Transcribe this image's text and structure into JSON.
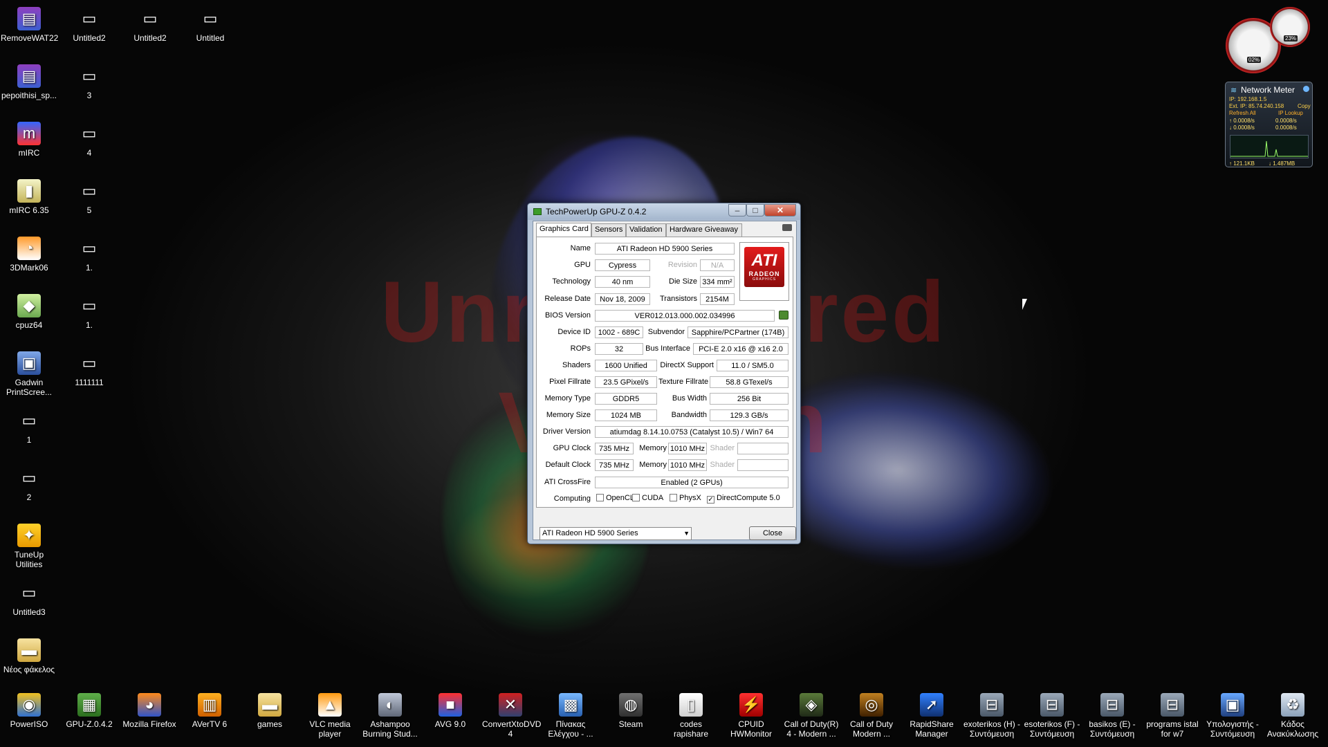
{
  "watermark": {
    "line1": "Unregistered",
    "line2": "Version"
  },
  "desktop_icons_left": [
    {
      "label": "RemoveWAT22",
      "icon": "winrar-archive-icon"
    },
    {
      "label": "Untitled2",
      "icon": "image-file-icon"
    },
    {
      "label": "Untitled2",
      "icon": "image-file-icon"
    },
    {
      "label": "Untitled",
      "icon": "image-file-icon"
    },
    {
      "label": "pepoithisi_sp...",
      "icon": "winrar-archive-icon"
    },
    {
      "label": "3",
      "icon": "image-file-icon"
    },
    {
      "label": "mIRC",
      "icon": "mirc-icon"
    },
    {
      "label": "4",
      "icon": "image-file-icon"
    },
    {
      "label": "mIRC 6.35",
      "icon": "installer-icon"
    },
    {
      "label": "5",
      "icon": "image-file-icon"
    },
    {
      "label": "3DMark06",
      "icon": "3dmark-icon"
    },
    {
      "label": "1.",
      "icon": "image-file-icon"
    },
    {
      "label": "cpuz64",
      "icon": "cpuz-icon"
    },
    {
      "label": "1.",
      "icon": "image-file-icon"
    },
    {
      "label": "Gadwin PrintScree...",
      "icon": "gadwin-icon"
    },
    {
      "label": "1111111",
      "icon": "image-file-icon"
    },
    {
      "label": "1",
      "icon": "image-file-icon"
    },
    {
      "label": "2",
      "icon": "image-file-icon"
    },
    {
      "label": "TuneUp Utilities",
      "icon": "tuneup-icon"
    },
    {
      "label": "Untitled3",
      "icon": "image-file-icon"
    },
    {
      "label": "Νέος φάκελος",
      "icon": "folder-icon"
    }
  ],
  "desktop_icons_bottom": [
    {
      "label": "PowerISO",
      "icon": "poweriso-icon"
    },
    {
      "label": "GPU-Z.0.4.2",
      "icon": "gpuz-icon"
    },
    {
      "label": "Mozilla Firefox",
      "icon": "firefox-icon"
    },
    {
      "label": "AVerTV 6",
      "icon": "avertv-icon"
    },
    {
      "label": "games",
      "icon": "folder-icon"
    },
    {
      "label": "VLC media player",
      "icon": "vlc-icon"
    },
    {
      "label": "Ashampoo Burning Stud...",
      "icon": "ashampoo-icon"
    },
    {
      "label": "AVG 9.0",
      "icon": "avg-icon"
    },
    {
      "label": "ConvertXtoDVD 4",
      "icon": "convertxtodvd-icon"
    },
    {
      "label": "Πίνακας Ελέγχου - ...",
      "icon": "control-panel-icon"
    },
    {
      "label": "Steam",
      "icon": "steam-icon"
    },
    {
      "label": "codes rapishare",
      "icon": "text-file-icon"
    },
    {
      "label": "CPUID HWMonitor",
      "icon": "hwmonitor-icon"
    },
    {
      "label": "Call of Duty(R) 4 - Modern ...",
      "icon": "cod4-icon"
    },
    {
      "label": "Call of Duty Modern ...",
      "icon": "cod-mw-icon"
    },
    {
      "label": "RapidShare Manager",
      "icon": "rapidshare-icon"
    },
    {
      "label": "exoterikos (H) - Συντόμευση",
      "icon": "drive-shortcut-icon"
    },
    {
      "label": "esoterikos (F) - Συντόμευση",
      "icon": "drive-shortcut-icon"
    },
    {
      "label": "basikos (E) - Συντόμευση",
      "icon": "drive-shortcut-icon"
    },
    {
      "label": "programs istal for w7",
      "icon": "drive-shortcut-icon"
    },
    {
      "label": "Υπολογιστής - Συντόμευση",
      "icon": "computer-icon"
    },
    {
      "label": "Κάδος Ανακύκλωσης",
      "icon": "recycle-bin-icon"
    }
  ],
  "gauge": {
    "cpu": "02%",
    "ram": "23%"
  },
  "network_meter": {
    "title": "Network Meter",
    "ip": "IP: 192.168.1.5",
    "ext_ip": "Ext. IP: 85.74.240.158",
    "copy": "Copy",
    "refresh": "Refresh All",
    "lookup": "IP Lookup",
    "up": "↑ 0.0008/s",
    "up2": "0.0008/s",
    "down": "↓ 0.0008/s",
    "down2": "0.0008/s",
    "total_up": "↑ 121.1KB",
    "total_down": "↓ 1.487MB"
  },
  "gpuz": {
    "title": "TechPowerUp GPU-Z 0.4.2",
    "tabs": [
      "Graphics Card",
      "Sensors",
      "Validation",
      "Hardware Giveaway"
    ],
    "logo": {
      "brand": "ATI",
      "sub": "RADEON",
      "sub2": "GRAPHICS"
    },
    "labels": {
      "name": "Name",
      "gpu": "GPU",
      "revision": "Revision",
      "technology": "Technology",
      "die_size": "Die Size",
      "release_date": "Release Date",
      "transistors": "Transistors",
      "bios": "BIOS Version",
      "device_id": "Device ID",
      "subvendor": "Subvendor",
      "rops": "ROPs",
      "bus_interface": "Bus Interface",
      "shaders": "Shaders",
      "directx": "DirectX Support",
      "pixel_fillrate": "Pixel Fillrate",
      "texture_fillrate": "Texture Fillrate",
      "memory_type": "Memory Type",
      "bus_width": "Bus Width",
      "memory_size": "Memory Size",
      "bandwidth": "Bandwidth",
      "driver": "Driver Version",
      "gpu_clock": "GPU Clock",
      "memory": "Memory",
      "shader": "Shader",
      "default_clock": "Default Clock",
      "crossfire": "ATI CrossFire",
      "computing": "Computing"
    },
    "values": {
      "name": "ATI Radeon HD 5900 Series",
      "gpu": "Cypress",
      "revision": "N/A",
      "technology": "40 nm",
      "die_size": "334 mm²",
      "release_date": "Nov 18, 2009",
      "transistors": "2154M",
      "bios": "VER012.013.000.002.034996",
      "device_id": "1002 - 689C",
      "subvendor": "Sapphire/PCPartner (174B)",
      "rops": "32",
      "bus_interface": "PCI-E 2.0 x16 @ x16 2.0",
      "shaders": "1600 Unified",
      "directx": "11.0 / SM5.0",
      "pixel_fillrate": "23.5 GPixel/s",
      "texture_fillrate": "58.8 GTexel/s",
      "memory_type": "GDDR5",
      "bus_width": "256 Bit",
      "memory_size": "1024 MB",
      "bandwidth": "129.3 GB/s",
      "driver": "atiumdag 8.14.10.0753 (Catalyst 10.5) / Win7 64",
      "gpu_clock": "735 MHz",
      "gpu_memory": "1010 MHz",
      "default_clock": "735 MHz",
      "default_memory": "1010 MHz",
      "crossfire": "Enabled (2 GPUs)"
    },
    "computing": [
      {
        "label": "OpenCL",
        "checked": false
      },
      {
        "label": "CUDA",
        "checked": false
      },
      {
        "label": "PhysX",
        "checked": false
      },
      {
        "label": "DirectCompute 5.0",
        "checked": true
      }
    ],
    "dropdown": "ATI Radeon HD 5900 Series",
    "close": "Close"
  }
}
